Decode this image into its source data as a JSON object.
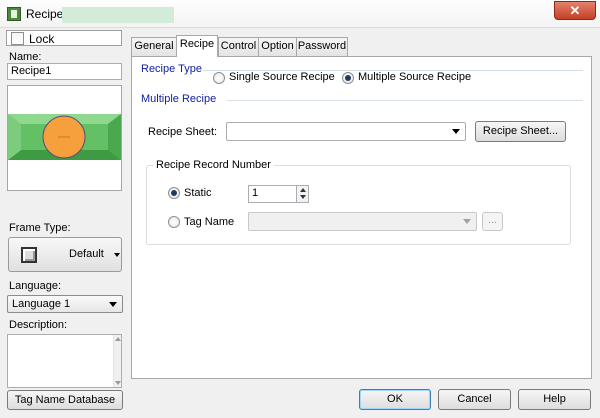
{
  "window": {
    "title": "Recipe",
    "close_glyph": "✕",
    "icon": "recipe-window-icon"
  },
  "left_panel": {
    "lock_label": "Lock",
    "name_label": "Name:",
    "name_value": "Recipe1",
    "frame_type_label": "Frame Type:",
    "frame_type_value": "Default",
    "language_label": "Language:",
    "language_value": "Language 1",
    "description_label": "Description:",
    "description_value": "",
    "tag_db_button": "Tag Name Database"
  },
  "tabs": [
    {
      "label": "General"
    },
    {
      "label": "Recipe",
      "active": true
    },
    {
      "label": "Control"
    },
    {
      "label": "Option"
    },
    {
      "label": "Password"
    }
  ],
  "recipe_type": {
    "title": "Recipe Type",
    "options": [
      {
        "label": "Single Source Recipe",
        "selected": false
      },
      {
        "label": "Multiple Source Recipe",
        "selected": true
      }
    ]
  },
  "multiple_recipe": {
    "title": "Multiple Recipe",
    "sheet_label": "Recipe Sheet:",
    "sheet_value": "",
    "sheet_button": "Recipe Sheet...",
    "record_group_title": "Recipe Record Number",
    "static_label": "Static",
    "static_selected": true,
    "static_value": "1",
    "tag_name_label": "Tag Name",
    "tag_name_selected": false,
    "tag_name_value": "",
    "browse_button": "..."
  },
  "footer": {
    "ok": "OK",
    "cancel": "Cancel",
    "help": "Help"
  },
  "colors": {
    "group_title": "#0f1ea0",
    "preview_green": "#63c064",
    "preview_orange": "#f5a03c",
    "close_red": "#c53f25"
  }
}
